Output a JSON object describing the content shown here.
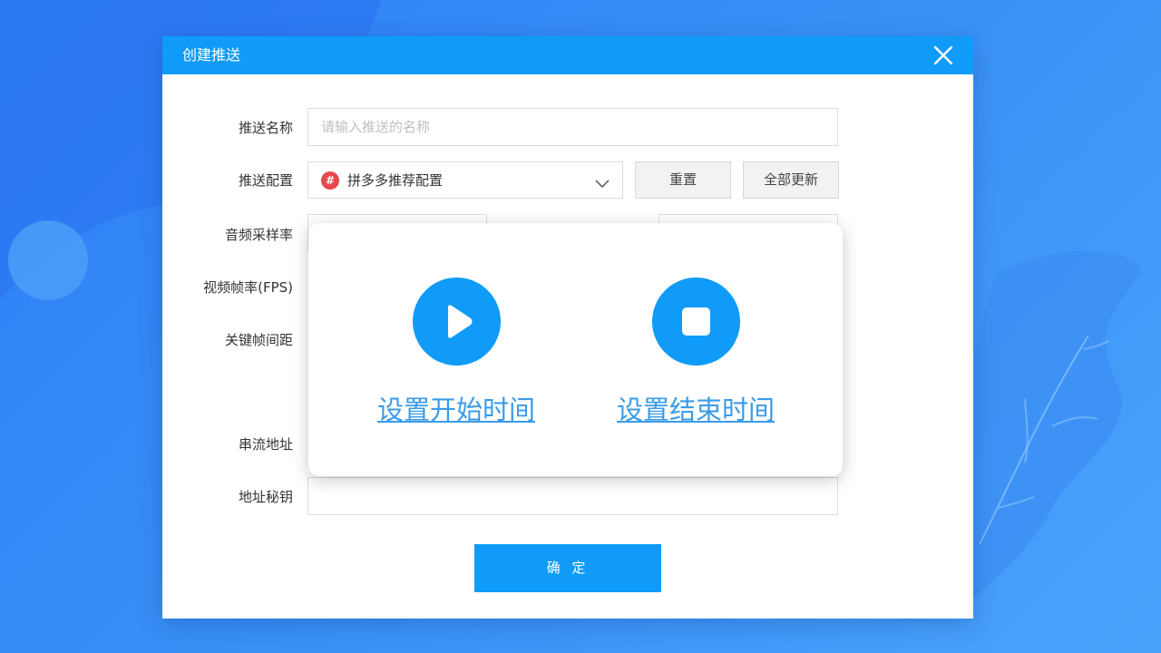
{
  "dialog": {
    "title": "创建推送",
    "close_icon": "close-icon"
  },
  "form": {
    "push_name": {
      "label": "推送名称",
      "placeholder": "请输入推送的名称",
      "value": ""
    },
    "push_config": {
      "label": "推送配置",
      "selected": "拼多多推荐配置",
      "badge_icon": "pinduoduo-logo-icon",
      "reset_label": "重置",
      "update_all_label": "全部更新"
    },
    "audio_sample_rate": {
      "label": "音频采样率"
    },
    "video_fps": {
      "label": "视频帧率(FPS)"
    },
    "keyframe_interval": {
      "label": "关键帧间距"
    },
    "stream_url": {
      "label": "串流地址"
    },
    "url_key": {
      "label": "地址秘钥",
      "value": ""
    },
    "confirm_label": "确 定"
  },
  "popup": {
    "start": {
      "icon": "play-icon",
      "label": "设置开始时间"
    },
    "end": {
      "icon": "stop-icon",
      "label": "设置结束时间"
    }
  },
  "colors": {
    "accent": "#0f9bf7",
    "link": "#3a9be8",
    "badge": "#e5484d"
  }
}
